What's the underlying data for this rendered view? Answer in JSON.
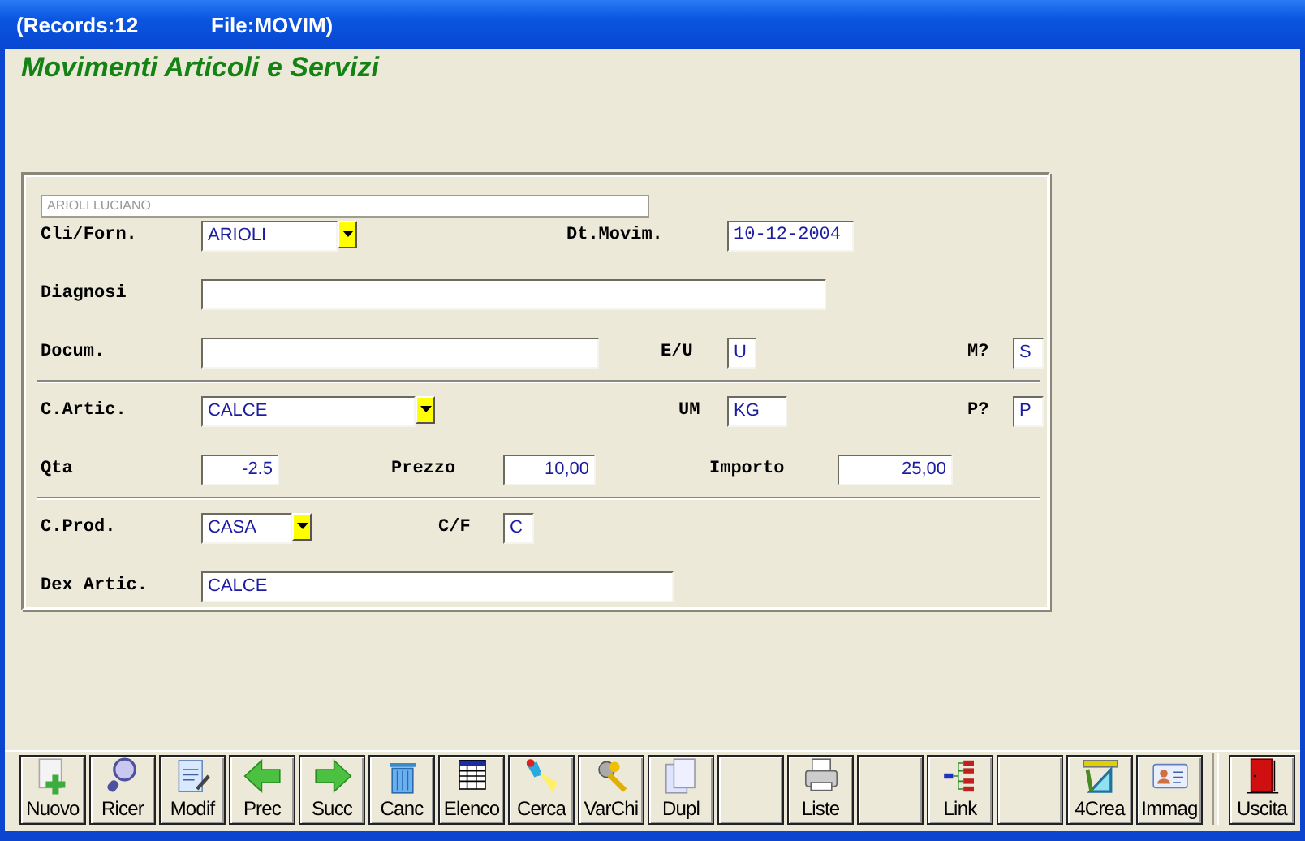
{
  "window": {
    "title_parts": [
      "(Records:12",
      "File:MOVIM)"
    ]
  },
  "heading": "Movimenti Articoli e Servizi",
  "form": {
    "header_value": "ARIOLI LUCIANO",
    "lines": [
      {
        "kind": "fields",
        "fields": [
          {
            "label": "Cli/Forn.",
            "kind": "combo",
            "value": "ARIOLI"
          },
          {
            "label": "Dt.Movim.",
            "kind": "date",
            "value": "10-12-2004"
          }
        ]
      },
      {
        "kind": "fields",
        "fields": [
          {
            "label": "Diagnosi",
            "kind": "text"
          }
        ]
      },
      {
        "kind": "fields",
        "fields": [
          {
            "label": "Docum.",
            "kind": "text"
          },
          {
            "label": "E/U",
            "kind": "text",
            "value": "U"
          },
          {
            "label": "M?",
            "kind": "text",
            "value": "S"
          }
        ]
      },
      {
        "kind": "divider"
      },
      {
        "kind": "fields",
        "fields": [
          {
            "label": "C.Artic.",
            "kind": "combo",
            "value": "CALCE"
          },
          {
            "label": "UM",
            "kind": "text",
            "value": "KG"
          },
          {
            "label": "P?",
            "kind": "text",
            "value": "P"
          }
        ]
      },
      {
        "kind": "fields",
        "fields": [
          {
            "label": "Qta",
            "kind": "number",
            "value": "-2.5"
          },
          {
            "label": "Prezzo",
            "kind": "number",
            "value": "10,00"
          },
          {
            "label": "Importo",
            "kind": "number",
            "value": "25,00"
          }
        ]
      },
      {
        "kind": "divider"
      },
      {
        "kind": "fields",
        "fields": [
          {
            "label": "C.Prod.",
            "kind": "combo",
            "value": "CASA"
          },
          {
            "label": "C/F",
            "kind": "text",
            "value": "C"
          }
        ]
      },
      {
        "kind": "fields",
        "fields": [
          {
            "label": "Dex Artic.",
            "kind": "text",
            "value": "CALCE"
          }
        ]
      }
    ]
  },
  "toolbar": [
    {
      "kind": "button",
      "label": "Nuovo"
    },
    {
      "kind": "button",
      "label": "Ricer"
    },
    {
      "kind": "button",
      "label": "Modif"
    },
    {
      "kind": "button",
      "label": "Prec"
    },
    {
      "kind": "button",
      "label": "Succ"
    },
    {
      "kind": "button",
      "label": "Canc"
    },
    {
      "kind": "button",
      "label": "Elenco"
    },
    {
      "kind": "button",
      "label": "Cerca"
    },
    {
      "kind": "button",
      "label": "VarChi"
    },
    {
      "kind": "button",
      "label": "Dupl"
    },
    {
      "kind": "blank"
    },
    {
      "kind": "button",
      "label": "Liste"
    },
    {
      "kind": "blank"
    },
    {
      "kind": "button",
      "label": "Link"
    },
    {
      "kind": "blank"
    },
    {
      "kind": "button",
      "label": "4Crea"
    },
    {
      "kind": "button",
      "label": "Immag"
    },
    {
      "kind": "separator"
    },
    {
      "kind": "button",
      "label": "Uscita"
    }
  ]
}
